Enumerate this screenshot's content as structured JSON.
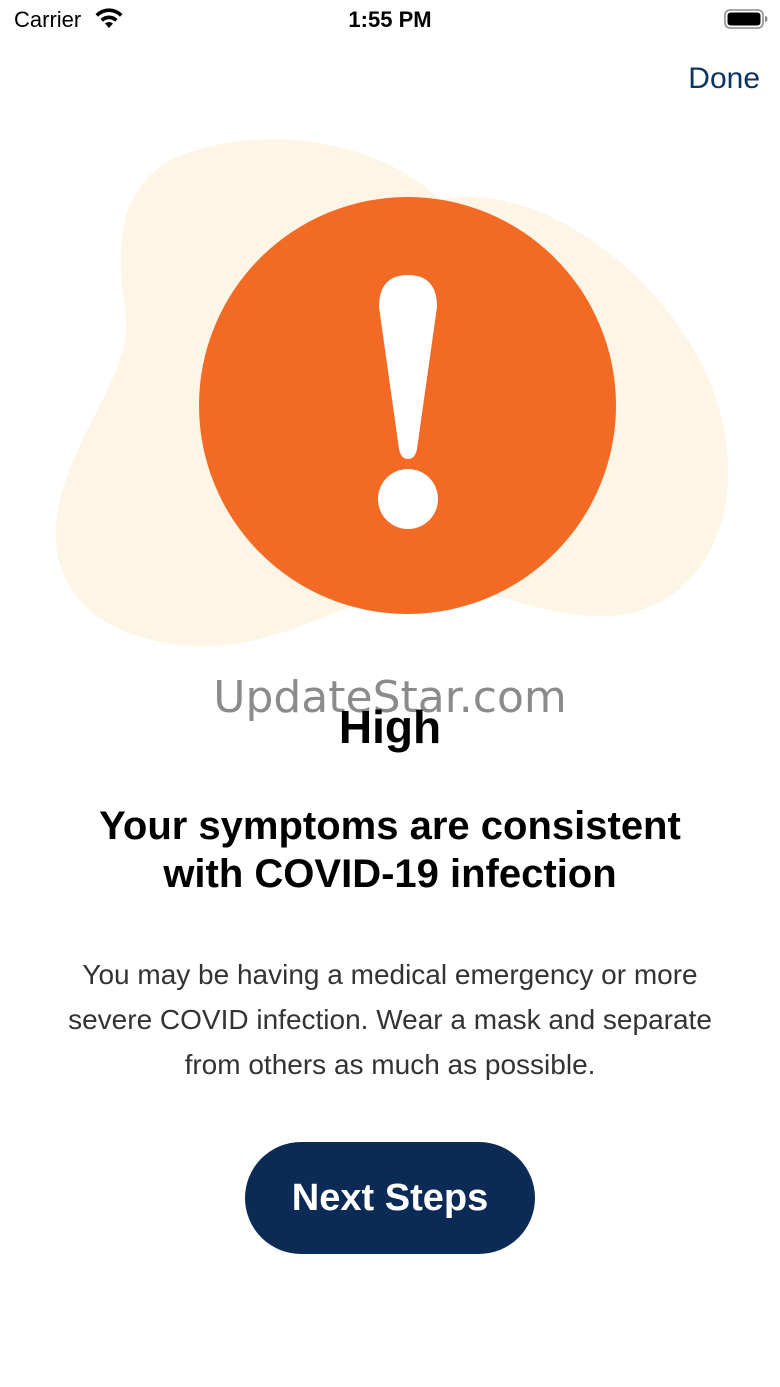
{
  "status_bar": {
    "carrier": "Carrier",
    "time": "1:55 PM",
    "wifi_icon": "wifi-icon",
    "battery_icon": "battery-icon"
  },
  "nav": {
    "done_label": "Done"
  },
  "illustration": {
    "blob_color": "#fdf5e6",
    "alert_color": "#f26a24",
    "icon": "exclamation-alert-icon"
  },
  "watermark": "UpdateStar.com",
  "result": {
    "risk_level": "High",
    "headline": "Your symptoms are consistent with COVID-19 infection",
    "body": "You may be having a medical emergency or more severe COVID infection. Wear a mask and separate from others as much as possible."
  },
  "actions": {
    "next_steps_label": "Next Steps",
    "button_color": "#0b2a55"
  }
}
